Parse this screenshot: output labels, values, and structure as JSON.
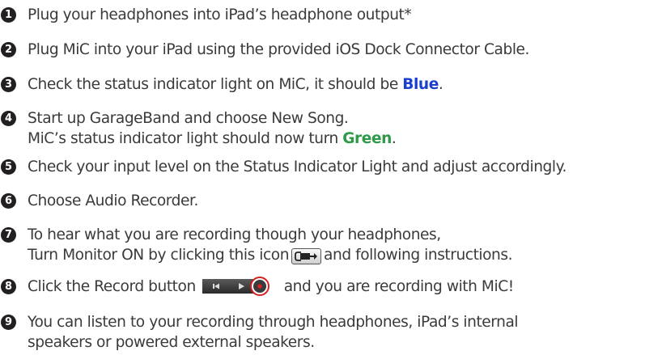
{
  "steps": [
    {
      "num": "1",
      "text": "Plug your headphones into iPad’s headphone output*"
    },
    {
      "num": "2",
      "text": "Plug MiC into your iPad using the provided iOS Dock Connector Cable."
    },
    {
      "num": "3",
      "text_before": "Check the status indicator light on MiC, it should be ",
      "highlight": "Blue",
      "text_after": "."
    },
    {
      "num": "4",
      "line1": "Start up GarageBand and choose New Song.",
      "line2_before": "MiC’s status indicator light should now turn ",
      "highlight": "Green",
      "line2_after": "."
    },
    {
      "num": "5",
      "text": "Check your input level on the Status Indicator Light and adjust accordingly."
    },
    {
      "num": "6",
      "text": "Choose Audio Recorder."
    },
    {
      "num": "7",
      "line1": "To hear what you are recording though your headphones,",
      "line2_before": "Turn Monitor ON by clicking this icon",
      "line2_after": "and following instructions."
    },
    {
      "num": "8",
      "text_before": "Click the Record button",
      "text_after": "and you are recording with MiC!"
    },
    {
      "num": "9",
      "line1": "You can listen to your recording through headphones, iPad’s internal",
      "line2": "speakers or powered external speakers."
    }
  ],
  "colors": {
    "text": "#3a3a3a",
    "blue_highlight": "#1a3fd0",
    "green_highlight": "#2e9a49",
    "number_badge": "#231f20",
    "record_ring": "#d81e1e"
  },
  "icons": {
    "monitor": "headphone-monitor-icon",
    "transport": [
      "rewind-icon",
      "play-icon",
      "record-icon"
    ]
  }
}
